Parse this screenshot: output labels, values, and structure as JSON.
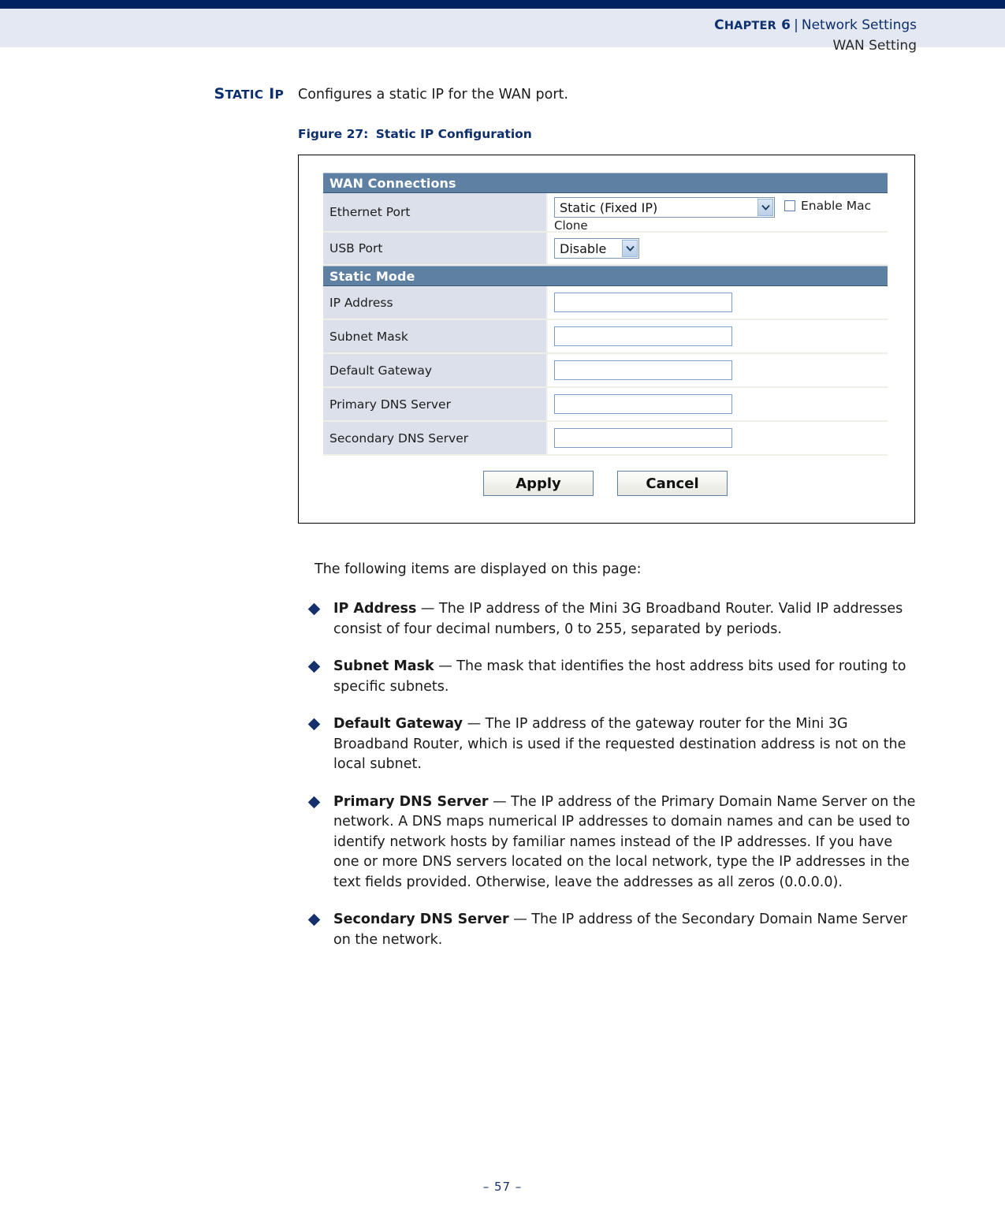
{
  "header": {
    "chapter_label": "Chapter 6",
    "separator": "|",
    "section": "Network Settings",
    "subsection": "WAN Setting"
  },
  "side_heading": "Static IP",
  "intro": "Configures a static IP for the WAN port.",
  "figure": {
    "number": "Figure 27:",
    "title": "Static IP Configuration"
  },
  "screenshot": {
    "wan_connections_header": "WAN Connections",
    "ethernet_port_label": "Ethernet Port",
    "ethernet_port_value": "Static (Fixed IP)",
    "enable_mac_label": "Enable Mac",
    "clone_label": "Clone",
    "usb_port_label": "USB Port",
    "usb_port_value": "Disable",
    "static_mode_header": "Static Mode",
    "fields": [
      {
        "label": "IP Address",
        "value": ""
      },
      {
        "label": "Subnet Mask",
        "value": ""
      },
      {
        "label": "Default Gateway",
        "value": ""
      },
      {
        "label": "Primary DNS Server",
        "value": ""
      },
      {
        "label": "Secondary DNS Server",
        "value": ""
      }
    ],
    "apply_label": "Apply",
    "cancel_label": "Cancel",
    "colors": {
      "section_header_bg": "#5d80a3",
      "row_label_bg": "#dbe0ea",
      "input_border": "#7c9ec4"
    }
  },
  "body": {
    "intro": "The following items are displayed on this page:",
    "bullets": [
      {
        "term": "IP Address",
        "dash": " — ",
        "text": "The IP address of the Mini 3G Broadband Router. Valid IP addresses consist of four decimal numbers, 0 to 255, separated by periods."
      },
      {
        "term": "Subnet Mask",
        "dash": " — ",
        "text": "The mask that identifies the host address bits used for routing to specific subnets."
      },
      {
        "term": "Default Gateway",
        "dash": " — ",
        "text": "The IP address of the gateway router for the Mini 3G Broadband Router, which is used if the requested destination address is not on the local subnet."
      },
      {
        "term": "Primary DNS Server",
        "dash": " — ",
        "text": "The IP address of the Primary Domain Name Server on the network. A DNS maps numerical IP addresses to domain names and can be used to identify network hosts by familiar names instead of the IP addresses. If you have one or more DNS servers located on the local network, type the IP addresses in the text fields provided. Otherwise, leave the addresses as all zeros (0.0.0.0)."
      },
      {
        "term": "Secondary DNS Server",
        "dash": " — ",
        "text": "The IP address of the Secondary Domain Name Server on the network."
      }
    ]
  },
  "footer": {
    "page": "–  57  –"
  }
}
